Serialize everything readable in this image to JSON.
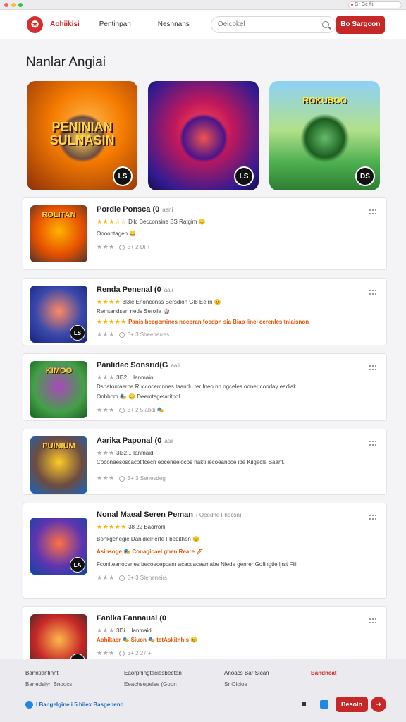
{
  "browser": {
    "url": "Gr Ge fli."
  },
  "nav": {
    "brand": "Aohiikisi",
    "links": [
      "Pentinpan",
      "Nesnnans"
    ],
    "search_placeholder": "Oelcokel",
    "cta": "Bo Sargcon"
  },
  "section_title": "Nanlar Angiai",
  "featured": [
    {
      "title": "PENINIAN SULNASIN",
      "badge": "LS"
    },
    {
      "title": "",
      "badge": "LS"
    },
    {
      "title": "ROKUBOO",
      "badge": "DS"
    }
  ],
  "games": [
    {
      "thumb_word": "ROLITAN",
      "badge": "",
      "title": "Pordie Ponsca (0",
      "subtitle": "aani",
      "stars": "★★★☆☆",
      "line1": "Dilc  Becconsine BS Ratgim 😊",
      "line2": "Oooontagen 😄",
      "line3": "",
      "footer_stars": "★★★",
      "footer_meta": "3+ 2 Di +"
    },
    {
      "thumb_word": "",
      "badge": "LS",
      "title": "Renda Penenal (0",
      "subtitle": "aaii",
      "stars": "★★★★",
      "line1": "3l3ie Enonconss Sersdion  Gl8 Eeirn 😊",
      "line2": "Remtandsen neds  Serolla 🎲",
      "line3": "Panis  becgemines nocpran foedpn sia Biap  Iinci cerenlcs tniaisnon",
      "footer_stars": "★★★",
      "footer_meta": "3+ 3 Sheenerres"
    },
    {
      "thumb_word": "KIMOO",
      "badge": "",
      "title": "Panlidec Sonsrid(G",
      "subtitle": "aaii",
      "stars": "★★★",
      "line1": "3l32...  Ianmaio",
      "line2": "Dsnatontaerne  Ruccocemnnes taandu ter Ineo nn ogceles ooner cooday eadiak",
      "line3": "Onbbom 🎭 😊  Deemtagetaritbol",
      "footer_stars": "★★★",
      "footer_meta": "3+ 2 5 abdi 🎭"
    },
    {
      "thumb_word": "PUINIUM",
      "badge": "",
      "title": "Aarika Paponal (0",
      "subtitle": "aaii",
      "stars": "★★★",
      "line1": "3l32...  Ianmaid",
      "line2": "Coconaesoscacotitcecn eoceneelocos hakti iecoeanoce ibe Kiigecle Saant.",
      "line3": "",
      "footer_stars": "★★★",
      "footer_meta": "3+ 3 Senesdeg"
    },
    {
      "thumb_word": "",
      "badge": "LA",
      "title": "Nonal Maeal Seren Peman",
      "subtitle": "( Oeedhe Fhocsn)",
      "stars": "★★★★★",
      "line1": "38 22 Baorroni",
      "line2": "Bonkgehegie  Danidielrierte Fbedithen 😊",
      "line3": "Asinsoge 🎭  Conagicael ghen Reare 🖊",
      "line4": "Fconiteanocenes  becoecepcanr acaccaceamabe Niede genrer  Gofingtie  ljrst Fiii",
      "footer_stars": "★★★",
      "footer_meta": "3+ 3 Steneneirs"
    },
    {
      "thumb_word": "",
      "badge": "LA",
      "title": "Fanika Fannaual (0",
      "subtitle": "",
      "stars": "★★★",
      "line1": "3l3i...  Ianmaid",
      "line2": "Aohikaer 🎭  Siuon 🎭  tetAskitnhis 😊",
      "line3": "",
      "footer_stars": "★★★",
      "footer_meta": "3+ 2 27 +"
    }
  ],
  "footer": {
    "col1": [
      "Banntiantinnt",
      "Banedsiyn Snoocs"
    ],
    "col2": [
      "Eaorphingtaciesbeetan",
      "Eeachsepelse (Goon"
    ],
    "col3": [
      "Anoacs Bar Sican",
      "Sr Oicioe"
    ],
    "col4": [
      "Bandneat"
    ],
    "bottom_text": "I Bangelgine i 5 hilex Basgenend",
    "btn": "Besoln"
  }
}
